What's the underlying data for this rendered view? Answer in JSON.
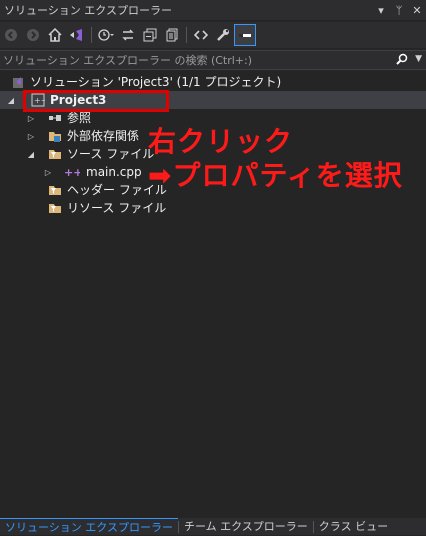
{
  "window": {
    "title": "ソリューション エクスプローラー",
    "controls": [
      "▾",
      "ᛘ",
      "✕"
    ]
  },
  "toolbar": {
    "items": [
      "back-icon",
      "forward-icon",
      "home-icon",
      "vs-switch-icon",
      "history-icon",
      "sync-icon",
      "collapse-all-icon",
      "show-all-files-icon",
      "view-code-icon",
      "properties-wrench-icon",
      "preview-selected-icon"
    ]
  },
  "search": {
    "placeholder": "ソリューション エクスプローラー の検索 (Ctrl+:)"
  },
  "tree": {
    "solution": "ソリューション 'Project3' (1/1 プロジェクト)",
    "project": "Project3",
    "references": "参照",
    "external_deps": "外部依存関係",
    "source_files": "ソース ファイル",
    "main_cpp": "main.cpp",
    "header_files": "ヘッダー ファイル",
    "resource_files": "リソース ファイル"
  },
  "annotation": {
    "line1": "右クリック",
    "line2": "➡プロパティを選択",
    "color": "#ff1a1a"
  },
  "bottom_tabs": {
    "solution_explorer": "ソリューション エクスプローラー",
    "team_explorer": "チーム エクスプローラー",
    "class_view": "クラス ビュー"
  },
  "colors": {
    "background": "#252526",
    "accent": "#3399ff",
    "highlight_box": "#e00000"
  }
}
